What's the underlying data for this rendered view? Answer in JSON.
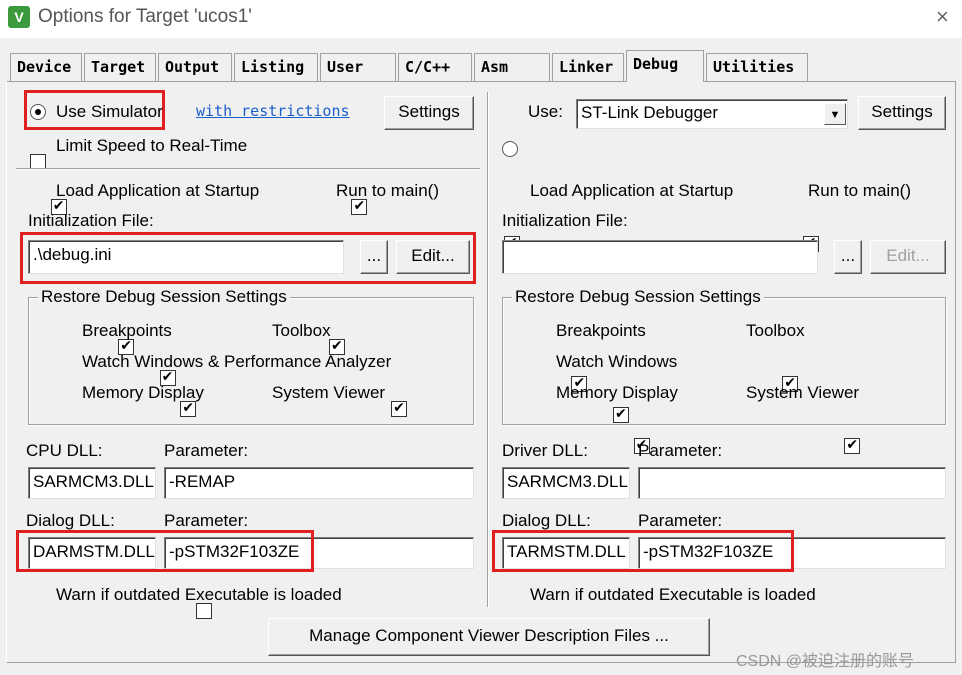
{
  "window": {
    "title": "Options for Target 'ucos1'",
    "app_icon": "keil-uvision-icon",
    "close": "×"
  },
  "tabs": [
    "Device",
    "Target",
    "Output",
    "Listing",
    "User",
    "C/C++",
    "Asm",
    "Linker",
    "Debug",
    "Utilities"
  ],
  "active_tab": "Debug",
  "left": {
    "use_simulator": "Use Simulator",
    "with_restrictions": "with restrictions",
    "settings": "Settings",
    "limit_speed": "Limit Speed to Real-Time",
    "load_app": "Load Application at Startup",
    "run_to_main": "Run to main()",
    "init_file_label": "Initialization File:",
    "init_file_value": ".\\debug.ini",
    "browse": "...",
    "edit": "Edit...",
    "restore_title": "Restore Debug Session Settings",
    "breakpoints": "Breakpoints",
    "toolbox": "Toolbox",
    "watch_windows": "Watch Windows & Performance Analyzer",
    "memory_display": "Memory Display",
    "system_viewer": "System Viewer",
    "cpu_dll_label": "CPU DLL:",
    "parameter_label": "Parameter:",
    "cpu_dll_value": "SARMCM3.DLL",
    "cpu_param_value": "-REMAP",
    "dialog_dll_label": "Dialog DLL:",
    "dialog_dll_value": "DARMSTM.DLL",
    "dialog_param_value": "-pSTM32F103ZE",
    "warn": "Warn if outdated Executable is loaded"
  },
  "right": {
    "use": "Use:",
    "debugger": "ST-Link Debugger",
    "settings": "Settings",
    "load_app": "Load Application at Startup",
    "run_to_main": "Run to main()",
    "init_file_label": "Initialization File:",
    "init_file_value": "",
    "browse": "...",
    "edit": "Edit...",
    "restore_title": "Restore Debug Session Settings",
    "breakpoints": "Breakpoints",
    "toolbox": "Toolbox",
    "watch_windows": "Watch Windows",
    "memory_display": "Memory Display",
    "system_viewer": "System Viewer",
    "driver_dll_label": "Driver DLL:",
    "parameter_label": "Parameter:",
    "driver_dll_value": "SARMCM3.DLL",
    "driver_param_value": "",
    "dialog_dll_label": "Dialog DLL:",
    "dialog_dll_value": "TARMSTM.DLL",
    "dialog_param_value": "-pSTM32F103ZE",
    "warn": "Warn if outdated Executable is loaded"
  },
  "manage_button": "Manage Component Viewer Description Files ...",
  "watermark": "CSDN @被迫注册的账号",
  "colors": {
    "highlight": "#e02020",
    "link": "#1a5fc8"
  }
}
